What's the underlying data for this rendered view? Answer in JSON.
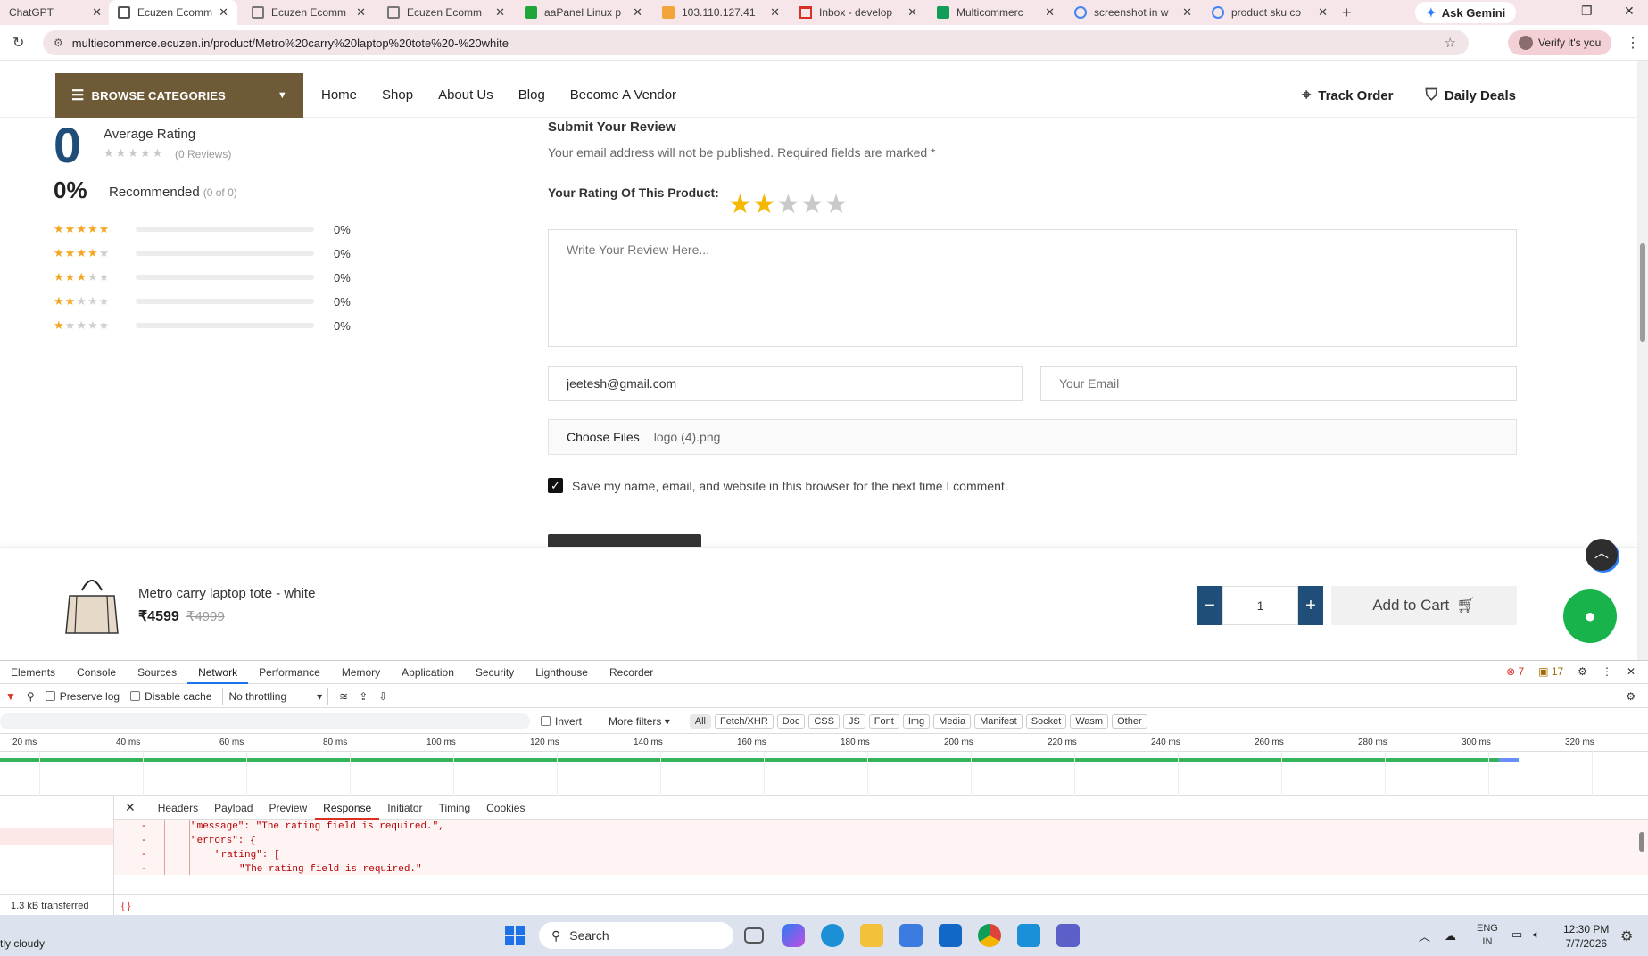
{
  "browser": {
    "tabs": [
      {
        "title": "ChatGPT",
        "active": false
      },
      {
        "title": "Ecuzen Ecomm",
        "active": true
      },
      {
        "title": "Ecuzen Ecomm",
        "active": false
      },
      {
        "title": "Ecuzen Ecomm",
        "active": false
      },
      {
        "title": "aaPanel Linux p",
        "active": false
      },
      {
        "title": "103.110.127.41",
        "active": false
      },
      {
        "title": "Inbox - develop",
        "active": false
      },
      {
        "title": "Multicommerc",
        "active": false
      },
      {
        "title": "screenshot in w",
        "active": false
      },
      {
        "title": "product sku co",
        "active": false
      }
    ],
    "ask_gemini": "Ask Gemini",
    "url": "multiecommerce.ecuzen.in/product/Metro%20carry%20laptop%20tote%20-%20white",
    "verify_label": "Verify it's you"
  },
  "nav": {
    "browse_label": "BROWSE CATEGORIES",
    "links": [
      "Home",
      "Shop",
      "About Us",
      "Blog",
      "Become A Vendor"
    ],
    "track_order": "Track Order",
    "daily_deals": "Daily Deals"
  },
  "rating_summary": {
    "average": "0",
    "average_label": "Average Rating",
    "reviews_count": "(0 Reviews)",
    "recommended_pct": "0%",
    "recommended_label": "Recommended",
    "recommended_of": "(0 of 0)",
    "breakdown": [
      {
        "stars": 5,
        "pct_label": "0%",
        "fraction": 0
      },
      {
        "stars": 4,
        "pct_label": "0%",
        "fraction": 0
      },
      {
        "stars": 3,
        "pct_label": "0%",
        "fraction": 0
      },
      {
        "stars": 2,
        "pct_label": "0%",
        "fraction": 0
      },
      {
        "stars": 1,
        "pct_label": "0%",
        "fraction": 0
      }
    ]
  },
  "review_form": {
    "title": "Submit Your Review",
    "note": "Your email address will not be published. Required fields are marked *",
    "rating_label": "Your Rating Of This Product:",
    "selected_rating": 2,
    "max_rating": 5,
    "review_placeholder": "Write Your Review Here...",
    "name_value": "jeetesh@gmail.com",
    "email_placeholder": "Your Email",
    "choose_files": "Choose Files",
    "file_name": "logo (4).png",
    "save_label": "Save my name, email, and website in this browser for the next time I comment.",
    "save_checked": true
  },
  "sticky_bar": {
    "product_name": "Metro carry laptop tote - white",
    "price": "₹4599",
    "old_price": "₹4999",
    "quantity": "1",
    "add_to_cart": "Add to Cart"
  },
  "devtools": {
    "tabs": [
      "Elements",
      "Console",
      "Sources",
      "Network",
      "Performance",
      "Memory",
      "Application",
      "Security",
      "Lighthouse",
      "Recorder"
    ],
    "active_tab": "Network",
    "errors": "7",
    "warnings": "17",
    "preserve_log": "Preserve log",
    "disable_cache": "Disable cache",
    "throttling": "No throttling",
    "invert": "Invert",
    "more_filters": "More filters",
    "filter_types": [
      "All",
      "Fetch/XHR",
      "Doc",
      "CSS",
      "JS",
      "Font",
      "Img",
      "Media",
      "Manifest",
      "Socket",
      "Wasm",
      "Other"
    ],
    "timeline_ticks": [
      "20 ms",
      "40 ms",
      "60 ms",
      "80 ms",
      "100 ms",
      "120 ms",
      "140 ms",
      "160 ms",
      "180 ms",
      "200 ms",
      "220 ms",
      "240 ms",
      "260 ms",
      "280 ms",
      "300 ms",
      "320 ms"
    ],
    "detail_tabs": [
      "Headers",
      "Payload",
      "Preview",
      "Response",
      "Initiator",
      "Timing",
      "Cookies"
    ],
    "active_detail_tab": "Response",
    "response_lines": [
      "\"message\": \"The rating field is required.\",",
      "\"errors\": {",
      "\"rating\": [",
      "\"The rating field is required.\""
    ],
    "transferred": "1.3 kB transferred",
    "braces": "{ }"
  },
  "taskbar": {
    "weather": "tly cloudy",
    "search_label": "Search",
    "lang_top": "ENG",
    "lang_bottom": "IN",
    "time": "12:30 PM",
    "date": "7/7/2026"
  },
  "colors": {
    "brand_brown": "#6f5a37",
    "accent_blue": "#1f4e79",
    "star_gold": "#f5b800",
    "chat_green": "#18b34b"
  }
}
